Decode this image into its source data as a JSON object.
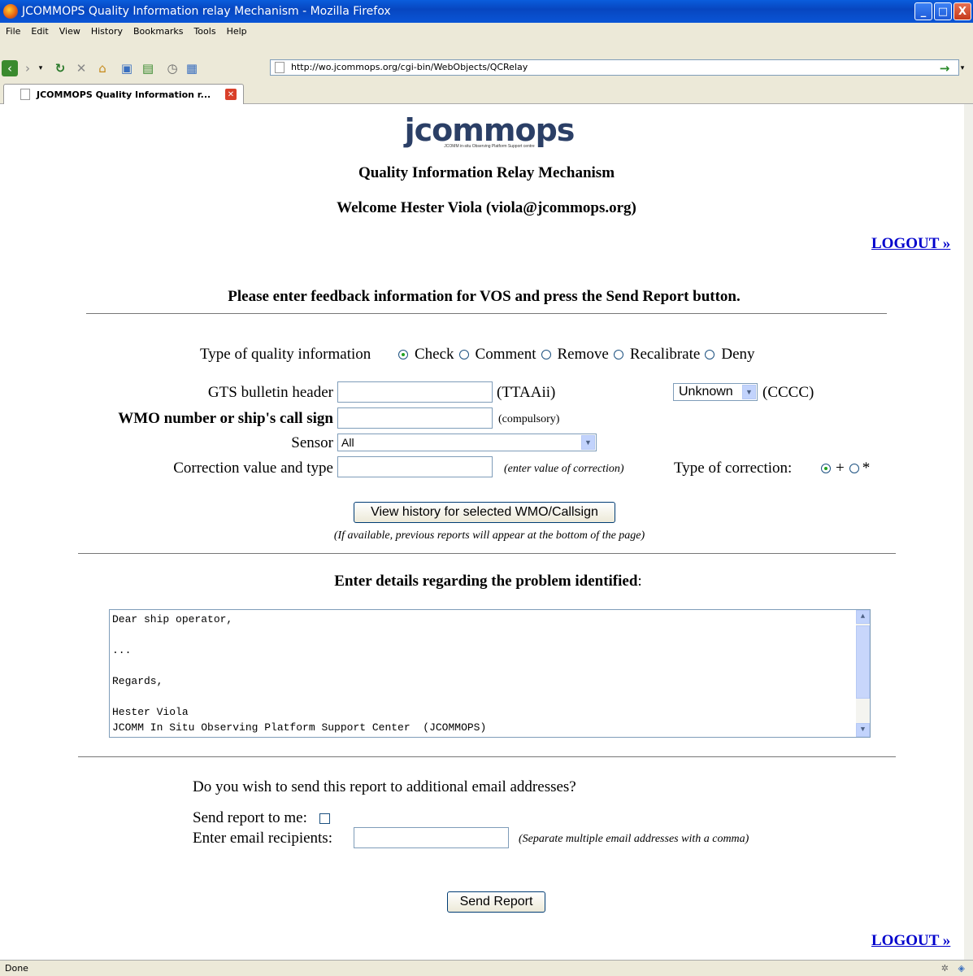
{
  "window": {
    "title": "JCOMMOPS Quality Information relay Mechanism - Mozilla Firefox",
    "minimize": "_",
    "maximize": "□",
    "close": "X"
  },
  "menu": [
    "File",
    "Edit",
    "View",
    "History",
    "Bookmarks",
    "Tools",
    "Help"
  ],
  "toolbar": {
    "url": "http://wo.jcommops.org/cgi-bin/WebObjects/QCRelay"
  },
  "tab": {
    "label": "JCOMMOPS Quality Information r..."
  },
  "page": {
    "logo_text": "jcommops",
    "logo_sub": "JCOMM in-situ Observing Platform Support centre",
    "heading": "Quality Information Relay Mechanism",
    "welcome": "Welcome Hester Viola (viola@jcommops.org)",
    "logout": "LOGOUT »",
    "instructions": "Please enter feedback information for VOS and press the Send Report button.",
    "type_label": "Type of quality information",
    "type_options": [
      "Check",
      "Comment",
      "Remove",
      "Recalibrate",
      "Deny"
    ],
    "type_selected": "Check",
    "gts_label": "GTS bulletin header",
    "gts_value": "",
    "gts_hint": "(TTAAii)",
    "cccc_selected": "Unknown",
    "cccc_hint": "(CCCC)",
    "wmo_label": "WMO number or ship's call sign",
    "wmo_value": "",
    "wmo_hint": "(compulsory)",
    "sensor_label": "Sensor",
    "sensor_selected": "All",
    "correction_label": "Correction value and type",
    "correction_value": "",
    "correction_hint": "(enter value of correction)",
    "correction_type_label": "Type of correction:",
    "correction_types": [
      "+",
      "*"
    ],
    "correction_type_selected": "+",
    "history_button": "View history for selected WMO/Callsign",
    "history_note": "(If available, previous reports will appear at the bottom of the page)",
    "details_heading": "Enter details regarding the problem identified",
    "details_colon": ":",
    "details_lines": [
      "Dear ship operator,",
      "",
      "...",
      "",
      "Regards,",
      "",
      "Hester Viola",
      "JCOMM In Situ Observing Platform Support Center  (JCOMMOPS)"
    ],
    "additional_question": "Do you wish to send this report to additional email addresses?",
    "send_to_me_label": "Send report to me:",
    "send_to_me_checked": false,
    "recipients_label": "Enter email recipients:",
    "recipients_value": "",
    "recipients_hint": "(Separate multiple email addresses with a comma)",
    "send_button": "Send Report"
  },
  "status": {
    "text": "Done"
  }
}
